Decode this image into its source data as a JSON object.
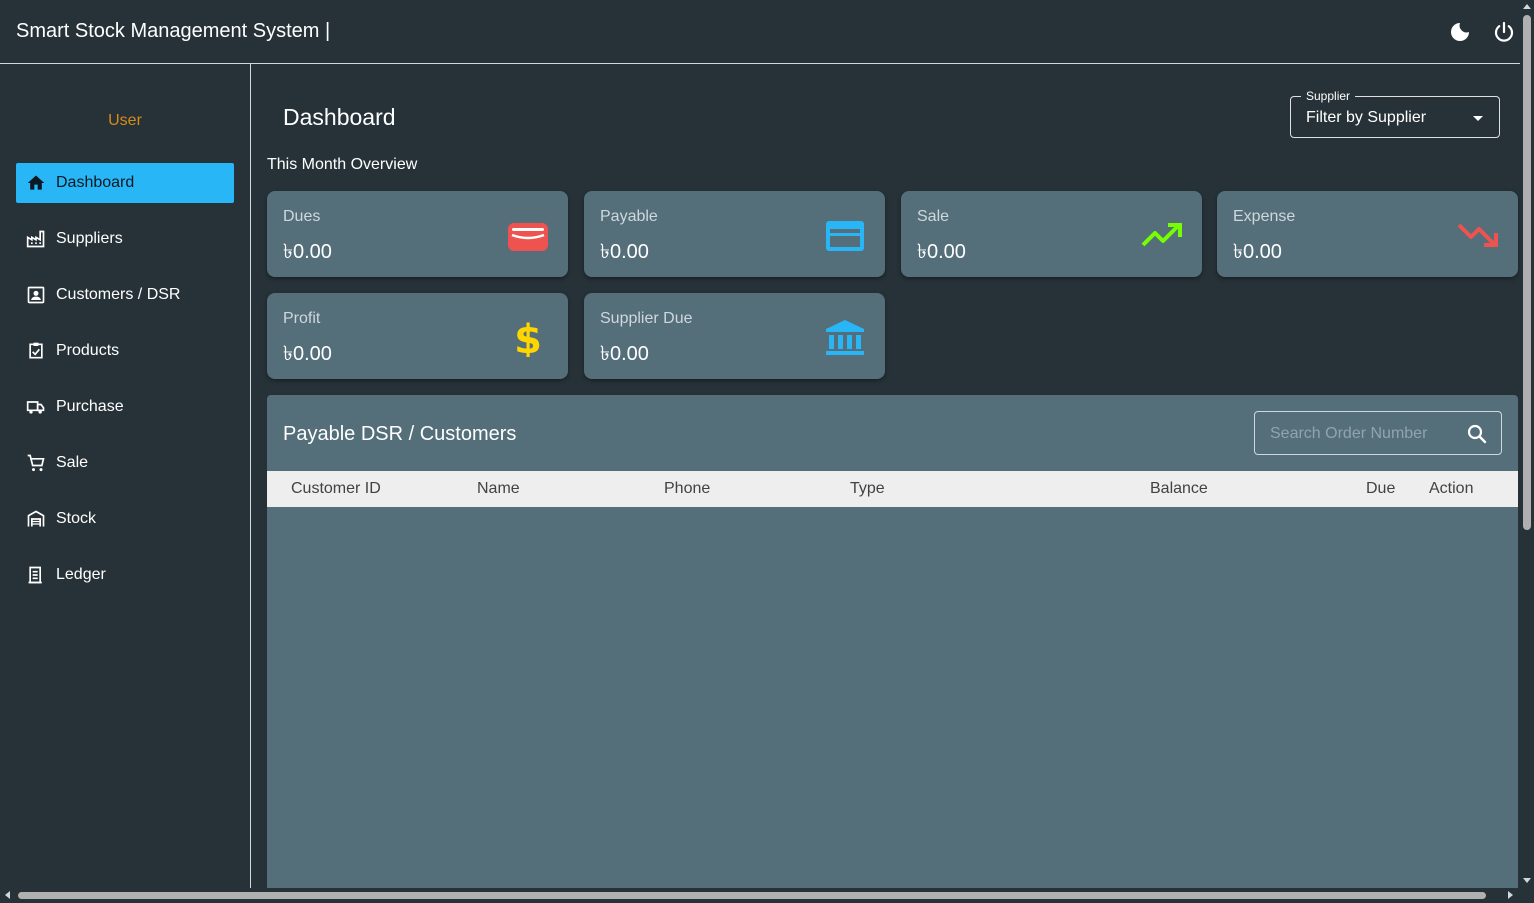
{
  "app": {
    "title": "Smart Stock Management System |"
  },
  "sidebar": {
    "user_label": "User",
    "items": [
      {
        "label": "Dashboard",
        "icon": "home-icon",
        "active": true
      },
      {
        "label": "Suppliers",
        "icon": "factory-icon"
      },
      {
        "label": "Customers / DSR",
        "icon": "contact-card-icon"
      },
      {
        "label": "Products",
        "icon": "checklist-icon"
      },
      {
        "label": "Purchase",
        "icon": "truck-icon"
      },
      {
        "label": "Sale",
        "icon": "cart-icon"
      },
      {
        "label": "Stock",
        "icon": "warehouse-icon"
      },
      {
        "label": "Ledger",
        "icon": "ledger-icon"
      }
    ]
  },
  "main": {
    "page_title": "Dashboard",
    "overview_label": "This Month Overview",
    "supplier_filter": {
      "legend": "Supplier",
      "value": "Filter by Supplier"
    },
    "cards": [
      {
        "label": "Dues",
        "value": "৳0.00",
        "icon": "wallet-icon",
        "color": "#ef5350"
      },
      {
        "label": "Payable",
        "value": "৳0.00",
        "icon": "credit-card-icon",
        "color": "#29b6f6"
      },
      {
        "label": "Sale",
        "value": "৳0.00",
        "icon": "trending-up-icon",
        "color": "#76ff03"
      },
      {
        "label": "Expense",
        "value": "৳0.00",
        "icon": "trending-down-icon",
        "color": "#ef5350"
      },
      {
        "label": "Profit",
        "value": "৳0.00",
        "icon": "dollar-icon",
        "color": "#ffd600"
      },
      {
        "label": "Supplier Due",
        "value": "৳0.00",
        "icon": "bank-icon",
        "color": "#29b6f6"
      }
    ],
    "table": {
      "title": "Payable DSR / Customers",
      "search_placeholder": "Search Order Number",
      "columns": [
        "Customer ID",
        "Name",
        "Phone",
        "Type",
        "Balance",
        "Due",
        "Action"
      ]
    }
  },
  "colors": {
    "background": "#263238",
    "card": "#546e7a",
    "accent": "#29b6f6",
    "user_label": "#d68a1a"
  }
}
